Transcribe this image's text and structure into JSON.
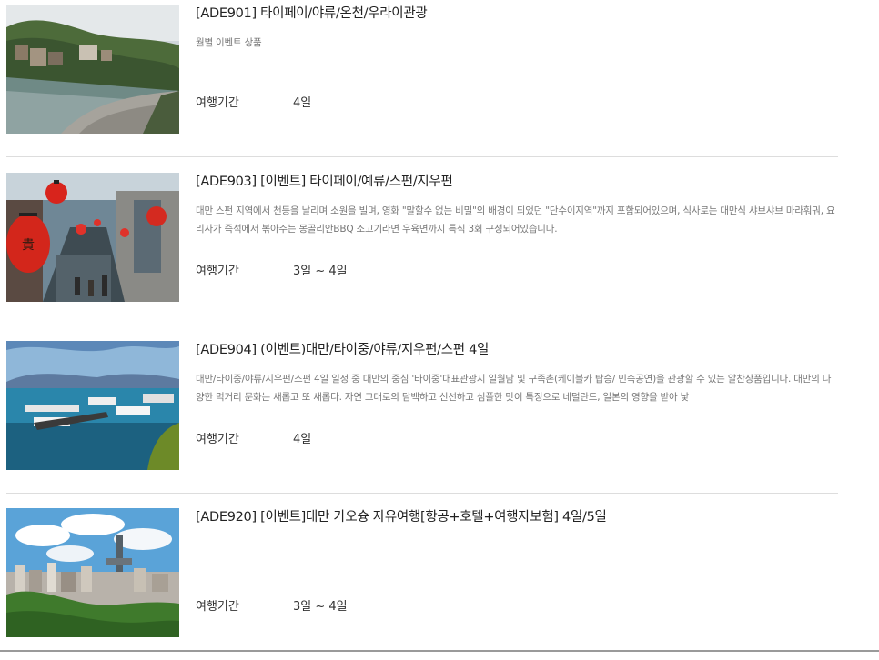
{
  "products": [
    {
      "title": "[ADE901] 타이페이/야류/온천/우라이관광",
      "desc": "월별 이벤트 상품",
      "period_label": "여행기간",
      "period_value": "4일",
      "image": "riverside-village-photo"
    },
    {
      "title": "[ADE903] [이벤트] 타이페이/예류/스펀/지우펀",
      "desc": "대만 스펀 지역에서 천등을 날리며 소원을 빌며, 영화 \"말할수 없는 비밀\"의 배경이 되었던 \"단수이지역\"까지 포함되어있으며, 식사로는 대만식 샤브샤브 마라훠궈, 요리사가 즉석에서 볶아주는 몽골리안BBQ 소고기라면 우육면까지 특식 3회 구성되어있습니다.",
      "period_label": "여행기간",
      "period_value": "3일 ~ 4일",
      "image": "red-lantern-street-photo"
    },
    {
      "title": "[ADE904] (이벤트)대만/타이중/야류/지우펀/스펀 4일",
      "desc": "대만/타이중/야류/지우펀/스펀 4일 일정 중 대만의 중심 '타이중'대표관광지 일월담 및 구족촌(케이블카 탑승/ 민속공연)을 관광할 수 있는 알찬상품입니다. 대만의 다양한 먹거리 문화는 새롭고 또 새롭다. 자연 그대로의 담백하고 신선하고 심플한 맛이 특징으로 네덜란드, 일본의 영향을 받아 낯",
      "period_label": "여행기간",
      "period_value": "4일",
      "image": "lake-harbor-photo"
    },
    {
      "title": "[ADE920] [이벤트]대만 가오슝 자유여행[항공+호텔+여행자보험] 4일/5일",
      "desc": "",
      "period_label": "여행기간",
      "period_value": "3일 ~ 4일",
      "image": "city-skyline-photo"
    }
  ]
}
